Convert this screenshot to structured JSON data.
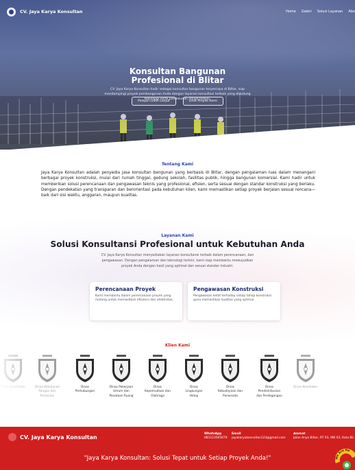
{
  "nav": {
    "brand": "CV. Jaya Karya Konsultan",
    "links": [
      "Home",
      "Galeri",
      "Solusi Layanan",
      "Abo"
    ]
  },
  "hero": {
    "title": "Konsultan Bangunan Profesional di Blitar",
    "description": "CV. Jaya Karya Konsultan hadir sebagai konsultan bangunan terpercaya di Blitar, siap mendampingi proyek pembangunan Anda dengan layanan konsultasi terbaik yang didukung teknologi serta pendekatan ilmiah terkini.",
    "btn_primary": "Pelajari Lebih Lanjut",
    "btn_secondary": "Lihat Proyek Kami"
  },
  "about": {
    "kicker": "Tentang Kami",
    "body": "Jaya Karya Konsultan adalah penyedia jasa konsultan bangunan yang berbasis di Blitar, dengan pengalaman luas dalam menangani berbagai proyek konstruksi, mulai dari rumah tinggal, gedung sekolah, fasilitas publik, hingga bangunan komersial. Kami hadir untuk memberikan solusi perencanaan dan pengawasan teknis yang profesional, efisien, serta sesuai dengan standar konstruksi yang berlaku. Dengan pendekatan yang transparan dan berorientasi pada kebutuhan klien, kami memastikan setiap proyek berjalan sesuai rencana—baik dari sisi waktu, anggaran, maupun kualitas."
  },
  "services": {
    "kicker": "Layanan Kami",
    "title": "Solusi Konsultansi Profesional untuk Kebutuhan Anda",
    "description": "CV. Jaya Karya Konsultan menyediakan layanan konsultansi terbaik dalam perencanaan, dan pengawasan. Dengan pengalaman dan teknologi terkini, kami siap membantu mewujudkan proyek Anda dengan hasil yang optimal dan sesuai standar industri.",
    "cards": [
      {
        "title": "Perencanaan Proyek",
        "text": "Kami membantu dalam perencanaan proyek yang matang untuk memastikan efisiensi dan efektivitas."
      },
      {
        "title": "Pengawasan Konstruksi",
        "text": "Pengawasan ketat terhadap setiap tahap konstruksi guna memastikan kualitas yang optimal."
      }
    ]
  },
  "clients": {
    "kicker": "Klien Kami",
    "items": [
      {
        "name": "Dinas Kesehatan",
        "faded": true
      },
      {
        "name": "Dinas Ketahanan Pangan dan Pertanian",
        "faded": true
      },
      {
        "name": "Dinas Perhubungan",
        "faded": false
      },
      {
        "name": "Dinas Pekerjaan Umum dan Penataan Ruang",
        "faded": false
      },
      {
        "name": "Dinas Kepemudaan dan Olahraga",
        "faded": false
      },
      {
        "name": "Dinas Lingkungan Hidup",
        "faded": false
      },
      {
        "name": "Dinas Kebudayaan dan Pariwisata",
        "faded": false
      },
      {
        "name": "Dinas Pendistribusian dan Perdagangan",
        "faded": false
      },
      {
        "name": "Dinas Kesehatan",
        "faded": true
      }
    ]
  },
  "footer": {
    "brand": "CV. Jaya Karya Konsultan",
    "whatsapp_label": "WhatsApp",
    "whatsapp_value": "081123565679",
    "email_label": "Email",
    "email_value": "jayakaryakonsultan123@gmail.com",
    "address_label": "Alamat",
    "address_value": "Jalan Anyo Blitar, RT 03, RW 02, Kota Bli",
    "tagline": "\"Jaya Karya Konsultan: Solusi Tepat untuk Setiap Proyek Anda!\"",
    "badge_text": "We Are He"
  },
  "colors": {
    "accent_blue": "#2845b3",
    "accent_red": "#d01f1f",
    "navy": "#1b2a6b"
  }
}
